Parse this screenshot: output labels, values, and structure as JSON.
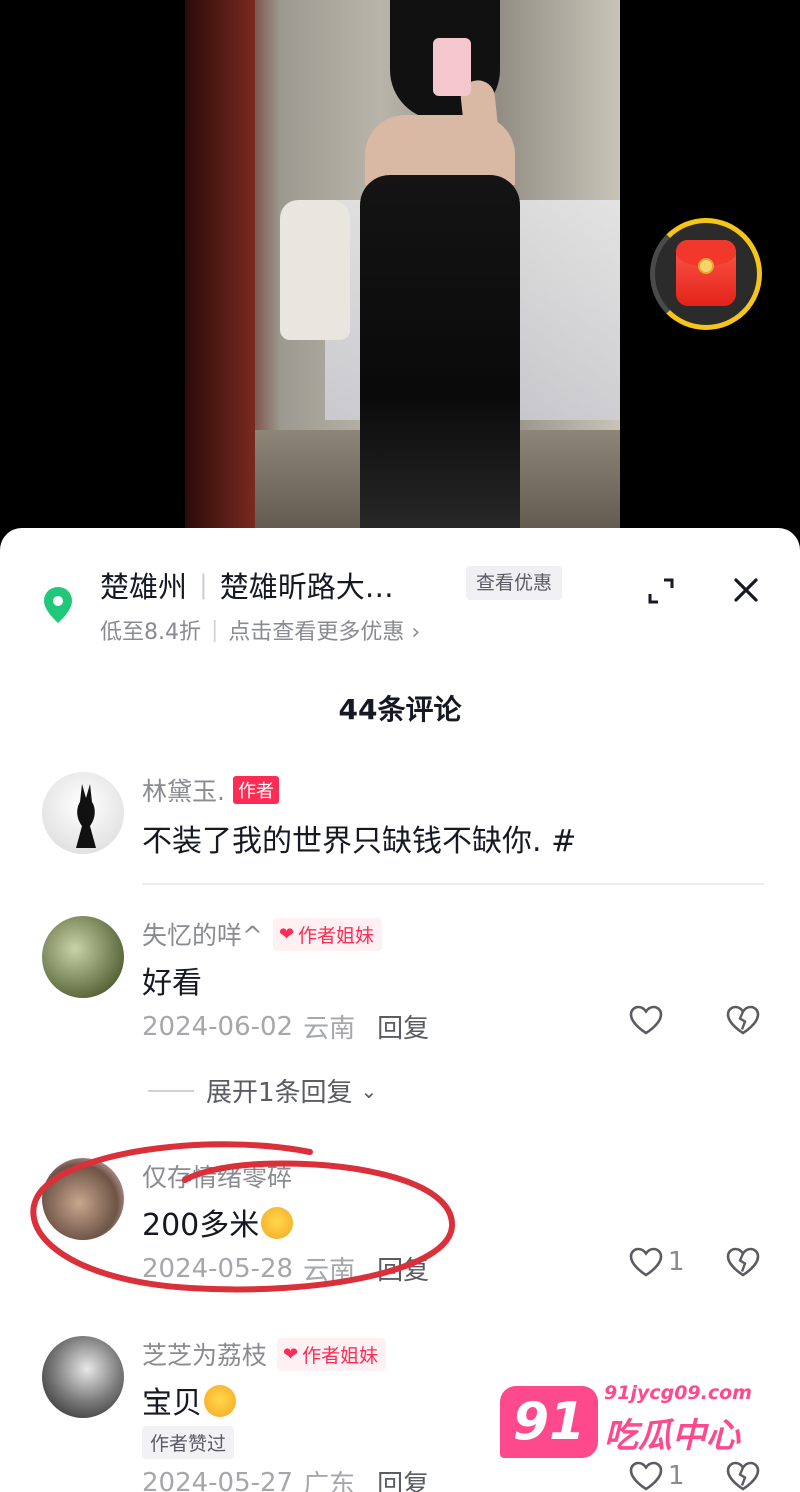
{
  "location": {
    "city": "楚雄州",
    "place": "楚雄昕路大…",
    "offer_button": "查看优惠",
    "discount": "低至8.4折",
    "more_offers": "点击查看更多优惠 ›"
  },
  "comments_title": "44条评论",
  "comments": [
    {
      "username": "林黛玉.",
      "badge": "作者",
      "text": "不装了我的世界只缺钱不缺你. #"
    },
    {
      "username": "失忆的咩^",
      "badge": "作者姐妹",
      "text": "好看",
      "date": "2024-06-02",
      "region": "云南",
      "reply_label": "回复",
      "likes": "",
      "expand_replies": "展开1条回复"
    },
    {
      "username": "仅存情绪零碎",
      "text": "200多米",
      "date": "2024-05-28",
      "region": "云南",
      "reply_label": "回复",
      "likes": "1"
    },
    {
      "username": "芝芝为荔枝",
      "badge": "作者姐妹",
      "text": "宝贝",
      "liked_by_author": "作者赞过",
      "date": "2024-05-27",
      "region": "广东",
      "reply_label": "回复",
      "likes": "1"
    }
  ],
  "watermark": {
    "badge": "91",
    "domain": "91jycg09.com",
    "name": "吃瓜中心"
  },
  "colors": {
    "accent": "#fe2c55",
    "location_pin": "#22c87a",
    "watermark": "#fe4a8c",
    "annotation_circle": "#d9303a"
  }
}
